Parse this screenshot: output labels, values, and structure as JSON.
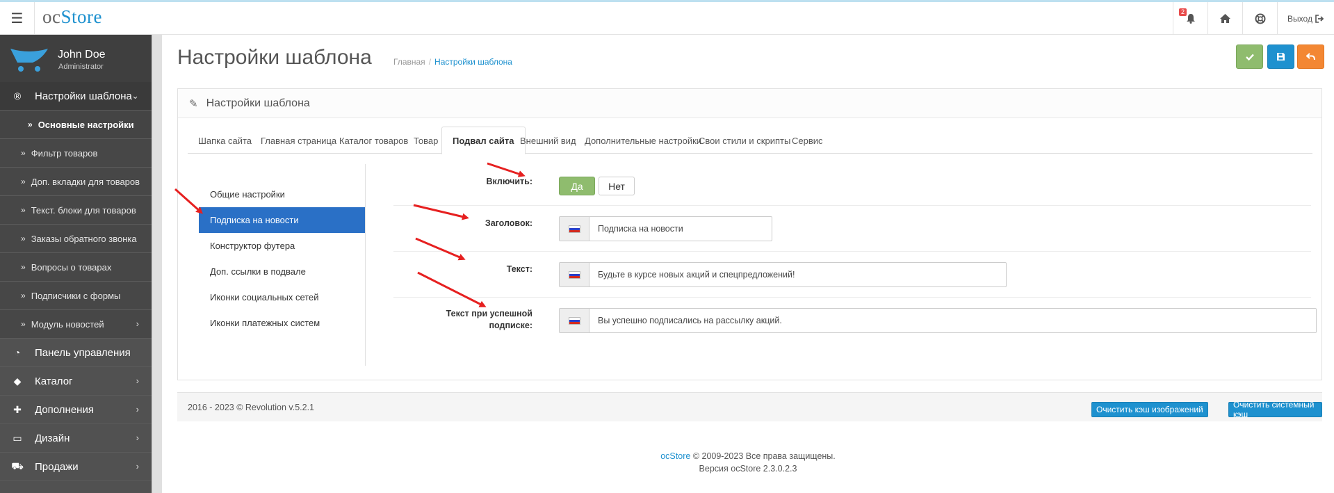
{
  "topbar": {
    "logo_oc": "oc",
    "logo_store": "Store",
    "notifications_count": "2",
    "logout_label": "Выход"
  },
  "user": {
    "name": "John Doe",
    "role": "Administrator"
  },
  "sidebar": {
    "active_section": "Настройки шаблона",
    "sub_items": [
      "Основные настройки",
      "Фильтр товаров",
      "Доп. вкладки для товаров",
      "Текст. блоки для товаров",
      "Заказы обратного звонка",
      "Вопросы о товарах",
      "Подписчики с формы",
      "Модуль новостей"
    ],
    "main_items": [
      "Панель управления",
      "Каталог",
      "Дополнения",
      "Дизайн",
      "Продажи"
    ]
  },
  "page": {
    "title": "Настройки шаблона",
    "breadcrumb_home": "Главная",
    "breadcrumb_current": "Настройки шаблона",
    "panel_title": "Настройки шаблона"
  },
  "tabs": [
    "Шапка сайта",
    "Главная страница",
    "Каталог товаров",
    "Товар",
    "Подвал сайта",
    "Внешний вид",
    "Дополнительные настройки",
    "Свои стили и скрипты",
    "Сервис"
  ],
  "vtabs": [
    "Общие настройки",
    "Подписка на новости",
    "Конструктор футера",
    "Доп. ссылки в подвале",
    "Иконки социальных сетей",
    "Иконки платежных систем"
  ],
  "form": {
    "enable_label": "Включить:",
    "yes": "Да",
    "no": "Нет",
    "title_label": "Заголовок:",
    "title_value": "Подписка на новости",
    "text_label": "Текст:",
    "text_value": "Будьте в курсе новых акций и спецпредложений!",
    "success_label_1": "Текст при успешной",
    "success_label_2": "подписке:",
    "success_value": "Вы успешно подписались на рассылку акций."
  },
  "footer": {
    "copyright": "2016 - 2023 © Revolution v.5.2.1",
    "clear_images_cache": "Очистить кэш изображений",
    "clear_system_cache": "Очистить системный кэш"
  },
  "bottom": {
    "brand": "ocStore",
    "rights": "© 2009-2023 Все права защищены.",
    "version": "Версия ocStore 2.3.0.2.3"
  },
  "colors": {
    "accent": "#1e91cf",
    "sidebar": "#515151",
    "save_green": "#8fbc6e",
    "cancel_orange": "#f38733",
    "active_vtab": "#2a70c6"
  }
}
